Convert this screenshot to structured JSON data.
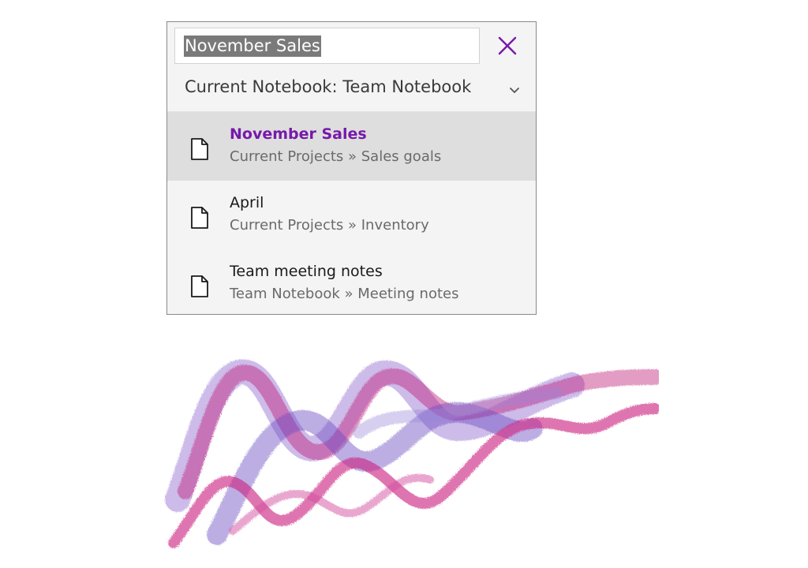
{
  "search": {
    "query": "November Sales",
    "close_icon": "close-icon"
  },
  "scope": {
    "label": "Current Notebook: Team Notebook",
    "icon": "chevron-down-icon"
  },
  "results": [
    {
      "title": "November Sales",
      "path": "Current Projects » Sales goals",
      "selected": true,
      "icon": "page-icon"
    },
    {
      "title": "April",
      "path": "Current Projects » Inventory",
      "selected": false,
      "icon": "page-icon"
    },
    {
      "title": "Team meeting notes",
      "path": "Team Notebook » Meeting notes",
      "selected": false,
      "icon": "page-icon"
    }
  ],
  "colors": {
    "accent": "#7719aa",
    "ribbon_magenta": "#c0207a",
    "ribbon_purple": "#7a4cc4",
    "ribbon_pink": "#d44fa0"
  }
}
